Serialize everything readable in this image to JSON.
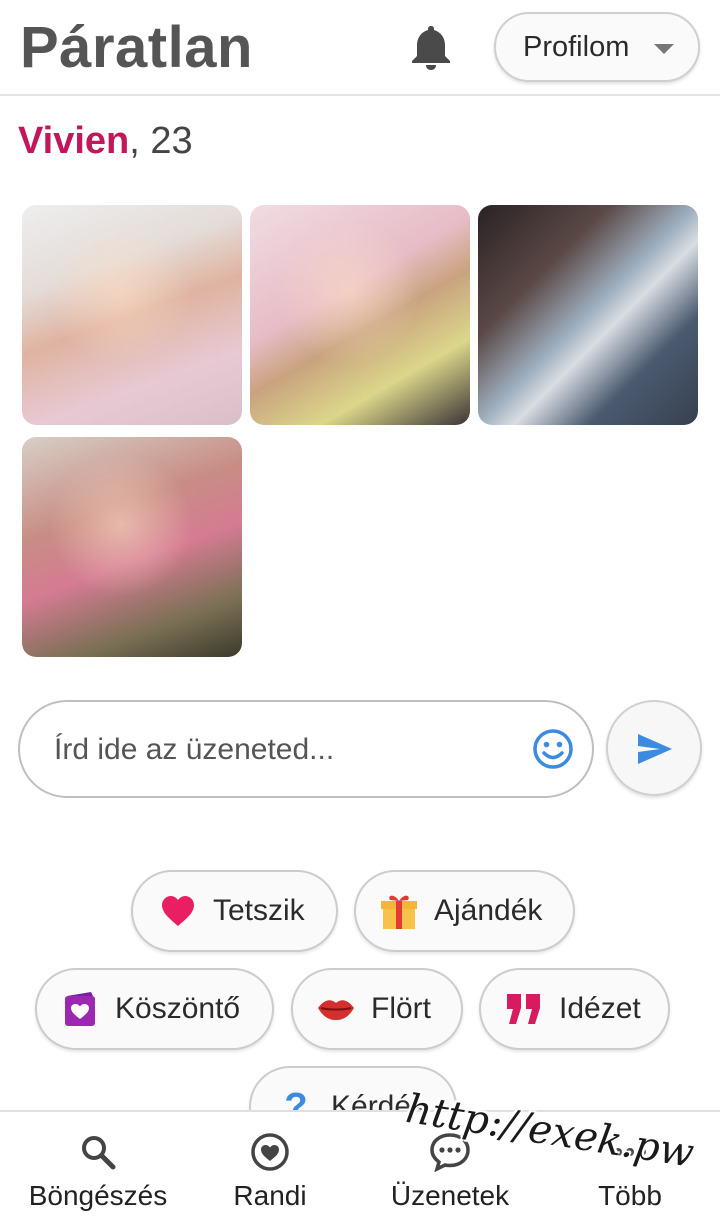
{
  "header": {
    "brand": "Páratlan",
    "bell_icon": "bell-icon",
    "profile_label": "Profilom"
  },
  "profile": {
    "name": "Vivien",
    "age_text": ", 23",
    "photos": [
      "photo-1",
      "photo-2",
      "photo-3",
      "photo-4"
    ]
  },
  "message": {
    "placeholder": "Írd ide az üzeneted...",
    "emoji_icon": "smiley-icon",
    "send_icon": "send-icon"
  },
  "quick_actions": [
    {
      "label": "Tetszik",
      "icon": "heart-icon"
    },
    {
      "label": "Ajándék",
      "icon": "gift-icon"
    },
    {
      "label": "Köszöntő",
      "icon": "card-heart-icon"
    },
    {
      "label": "Flört",
      "icon": "lips-icon"
    },
    {
      "label": "Idézet",
      "icon": "quote-icon"
    },
    {
      "label": "Kérdés",
      "icon": "question-icon"
    }
  ],
  "watermark": "http://exek.pw",
  "bottom_nav": [
    {
      "label": "Böngészés",
      "icon": "search-icon"
    },
    {
      "label": "Randi",
      "icon": "heart-circle-icon"
    },
    {
      "label": "Üzenetek",
      "icon": "chat-icon"
    },
    {
      "label": "Több",
      "icon": "more-icon"
    }
  ],
  "colors": {
    "accent_pink": "#c2185b",
    "heart": "#e91e63",
    "send_blue": "#3b8be0",
    "greet_purple": "#9c27b0",
    "quote_magenta": "#d81b60"
  }
}
